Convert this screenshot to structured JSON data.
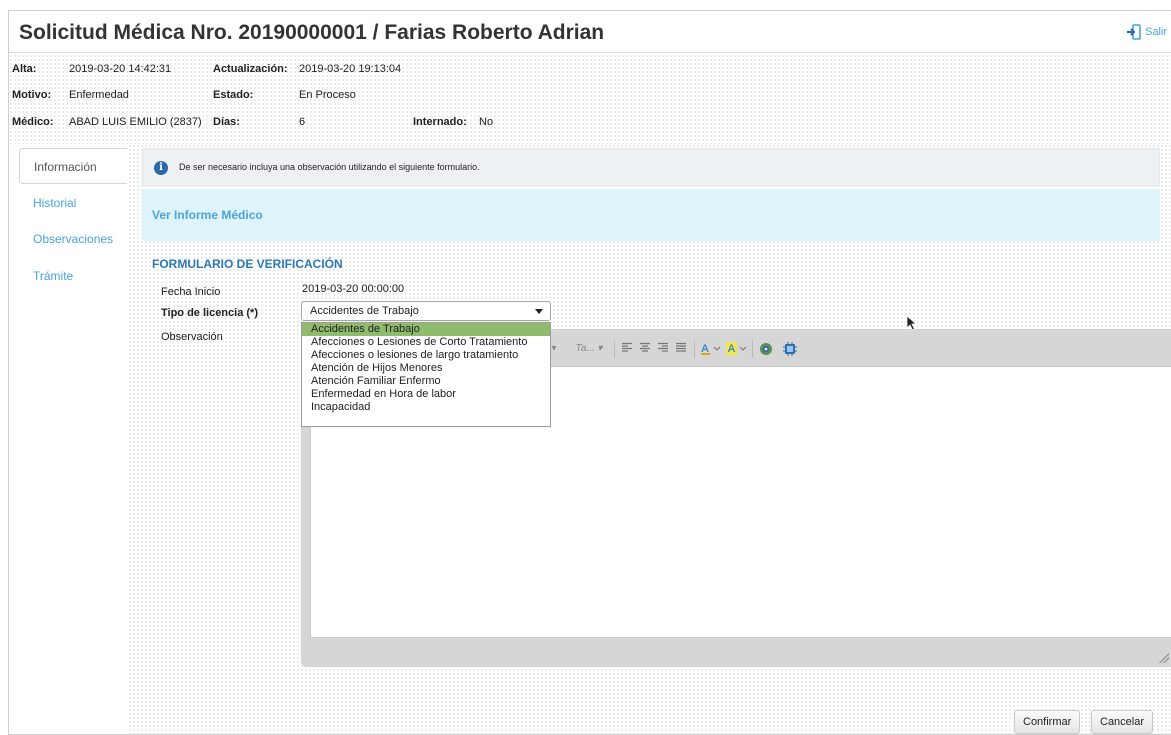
{
  "header": {
    "title": "Solicitud Médica Nro. 20190000001 / Farias Roberto Adrian",
    "logout_label": "Salir"
  },
  "meta": {
    "alta_label": "Alta:",
    "alta_value": "2019-03-20 14:42:31",
    "actualizacion_label": "Actualización:",
    "actualizacion_value": "2019-03-20 19:13:04",
    "motivo_label": "Motivo:",
    "motivo_value": "Enfermedad",
    "estado_label": "Estado:",
    "estado_value": "En Proceso",
    "medico_label": "Médico:",
    "medico_value": "ABAD LUIS EMILIO (2837)",
    "dias_label": "Días:",
    "dias_value": "6",
    "internado_label": "Internado:",
    "internado_value": "No"
  },
  "sidebar": {
    "tabs": [
      {
        "label": "Información",
        "active": true
      },
      {
        "label": "Historial",
        "active": false
      },
      {
        "label": "Observaciones",
        "active": false
      },
      {
        "label": "Trámite",
        "active": false
      }
    ]
  },
  "info": {
    "icon": "info-circle-icon",
    "message": "De ser necesario incluya una observación utilizando el siguiente formulario."
  },
  "informe_link": "Ver Informe Médico",
  "form": {
    "title": "FORMULARIO DE VERIFICACIÓN",
    "fecha_inicio_label": "Fecha Inicio",
    "fecha_inicio_value": "2019-03-20 00:00:00",
    "tipo_licencia_label": "Tipo de licencia (*)",
    "tipo_licencia_value": "Accidentes de Trabajo",
    "observacion_label": "Observación",
    "options": [
      "Accidentes de Trabajo",
      "Afecciones o Lesiones de Corto Tratamiento",
      "Afecciones o lesiones de largo tratamiento",
      "Atención de Hijos Menores",
      "Atención Familiar Enfermo",
      "Enfermedad en Hora de labor",
      "Incapacidad"
    ]
  },
  "editor_toolbar": {
    "font_size_placeholder": "Ta...",
    "icons": [
      "align-left-icon",
      "align-center-icon",
      "align-right-icon",
      "align-justify-icon",
      "text-color-icon",
      "background-color-icon",
      "image-icon",
      "video-icon"
    ]
  },
  "buttons": {
    "confirm": "Confirmar",
    "cancel": "Cancelar"
  },
  "colors": {
    "link": "#4aa3df",
    "form_title": "#2d79b8",
    "selected_option": "#8fbb6c",
    "info_icon": "#2b6aa8",
    "informe_bg": "#dff3fb"
  }
}
